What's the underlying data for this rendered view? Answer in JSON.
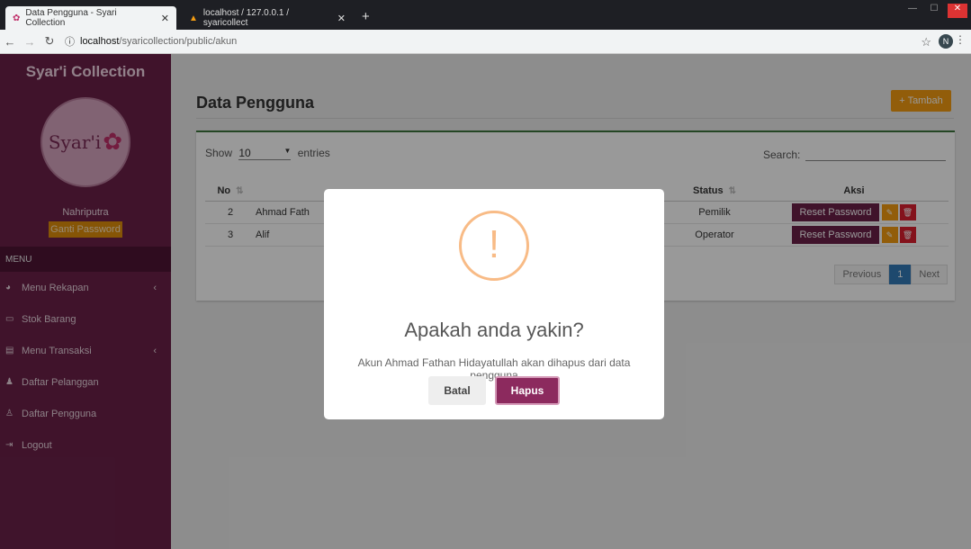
{
  "browser": {
    "tab1": {
      "title": "Data Pengguna - Syari Collection"
    },
    "tab2": {
      "title": "localhost / 127.0.0.1 / syaricollect"
    },
    "url": {
      "host": "localhost",
      "path": "/syaricollection/public/akun"
    },
    "profile_initial": "N"
  },
  "sidebar": {
    "brand": "Syar'i Collection",
    "logo_text": "Syar'i",
    "username": "Nahriputra",
    "change_password": "Ganti Password",
    "menu_header": "MENU",
    "items": [
      {
        "label": "Menu Rekapan",
        "icon": "pie-chart-icon",
        "glyph": "◕",
        "has_submenu": true
      },
      {
        "label": "Stok Barang",
        "icon": "laptop-icon",
        "glyph": "▭",
        "has_submenu": false
      },
      {
        "label": "Menu Transaksi",
        "icon": "file-icon",
        "glyph": "▤",
        "has_submenu": true
      },
      {
        "label": "Daftar Pelanggan",
        "icon": "users-icon",
        "glyph": "♟",
        "has_submenu": false
      },
      {
        "label": "Daftar Pengguna",
        "icon": "user-icon",
        "glyph": "♙",
        "has_submenu": false
      },
      {
        "label": "Logout",
        "icon": "sign-out-icon",
        "glyph": "⇥",
        "has_submenu": false
      }
    ]
  },
  "main": {
    "title": "Data Pengguna",
    "add_button": "+ Tambah",
    "show_label": "Show",
    "entries_value": "10",
    "entries_label": "entries",
    "search_label": "Search:",
    "table": {
      "headers": [
        "No",
        "",
        "",
        "Status",
        "Aksi"
      ],
      "rows": [
        {
          "no": "2",
          "name": "Ahmad Fath",
          "status": "Pemilik",
          "reset": "Reset Password"
        },
        {
          "no": "3",
          "name": "Alif",
          "status": "Operator",
          "reset": "Reset Password"
        }
      ]
    },
    "pagination": {
      "previous": "Previous",
      "current": "1",
      "next": "Next"
    }
  },
  "dialog": {
    "title": "Apakah anda yakin?",
    "text": "Akun Ahmad Fathan Hidayatullah akan dihapus dari data pengguna",
    "cancel": "Batal",
    "confirm": "Hapus"
  },
  "colors": {
    "sidebar": "#6b2149",
    "accent": "#f39c12",
    "danger": "#dd1e2f",
    "brand_button": "#8c2a5e"
  }
}
